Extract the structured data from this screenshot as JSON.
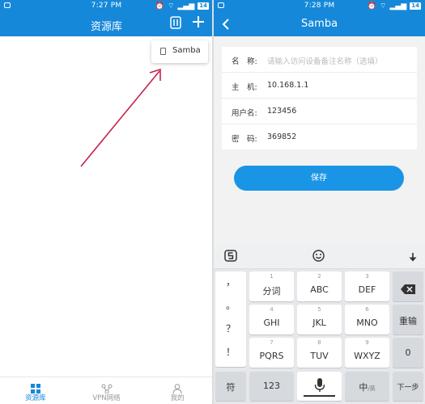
{
  "left": {
    "status": {
      "time": "7:27 PM",
      "battery": "14"
    },
    "appbar": {
      "title": "资源库"
    },
    "dropdown": {
      "item_label": "Samba"
    },
    "bottom_nav": [
      {
        "label": "资源库",
        "active": true
      },
      {
        "label": "VPN网络",
        "active": false
      },
      {
        "label": "我的",
        "active": false
      }
    ]
  },
  "right": {
    "status": {
      "time": "7:28 PM",
      "battery": "14"
    },
    "appbar": {
      "title": "Samba"
    },
    "form": {
      "name_label": "名　称:",
      "name_placeholder": "请输入访问设备备注名称（选填）",
      "host_label": "主　机:",
      "host_value": "10.168.1.1",
      "user_label": "用户名:",
      "user_value": "123456",
      "pass_label": "密　码:",
      "pass_value": "369852"
    },
    "save_label": "保存",
    "keyboard": {
      "symbols": [
        "，",
        "。",
        "？",
        "！"
      ],
      "keys": [
        {
          "num": "1",
          "main": "分词"
        },
        {
          "num": "2",
          "main": "ABC"
        },
        {
          "num": "3",
          "main": "DEF"
        },
        {
          "num": "4",
          "main": "GHI"
        },
        {
          "num": "5",
          "main": "JKL"
        },
        {
          "num": "6",
          "main": "MNO"
        },
        {
          "num": "7",
          "main": "PQRS"
        },
        {
          "num": "8",
          "main": "TUV"
        },
        {
          "num": "9",
          "main": "WXYZ"
        }
      ],
      "reenter_label": "重输",
      "zero_label": "0",
      "symbol_key_label": "符",
      "num_key_label": "123",
      "zh_key_label": "中",
      "zh_key_sub": "/英",
      "next_label": "下一步"
    }
  },
  "colors": {
    "primary": "#1688d9",
    "button": "#1a95e6",
    "arrow": "#c8234a"
  }
}
